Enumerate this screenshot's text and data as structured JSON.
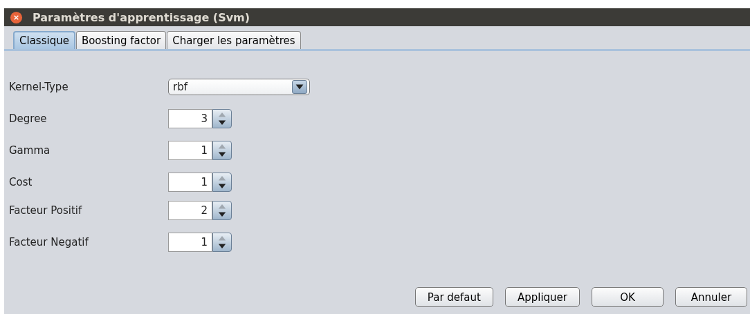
{
  "window": {
    "title": "Paramètres d'apprentissage (Svm)"
  },
  "tabs": [
    {
      "label": "Classique",
      "selected": true
    },
    {
      "label": "Boosting factor",
      "selected": false
    },
    {
      "label": "Charger les paramètres",
      "selected": false
    }
  ],
  "fields": [
    {
      "kind": "combo",
      "label": "Kernel-Type",
      "value": "rbf"
    },
    {
      "kind": "spinner",
      "label": "Degree",
      "value": "3"
    },
    {
      "kind": "spinner",
      "label": "Gamma",
      "value": "1"
    },
    {
      "kind": "spinner",
      "label": "Cost",
      "value": "1"
    },
    {
      "kind": "spinner",
      "label": "Facteur Positif",
      "value": "2"
    },
    {
      "kind": "spinner",
      "label": "Facteur Negatif",
      "value": "1"
    }
  ],
  "buttons": [
    "Par defaut",
    "Appliquer",
    "OK",
    "Annuler"
  ]
}
